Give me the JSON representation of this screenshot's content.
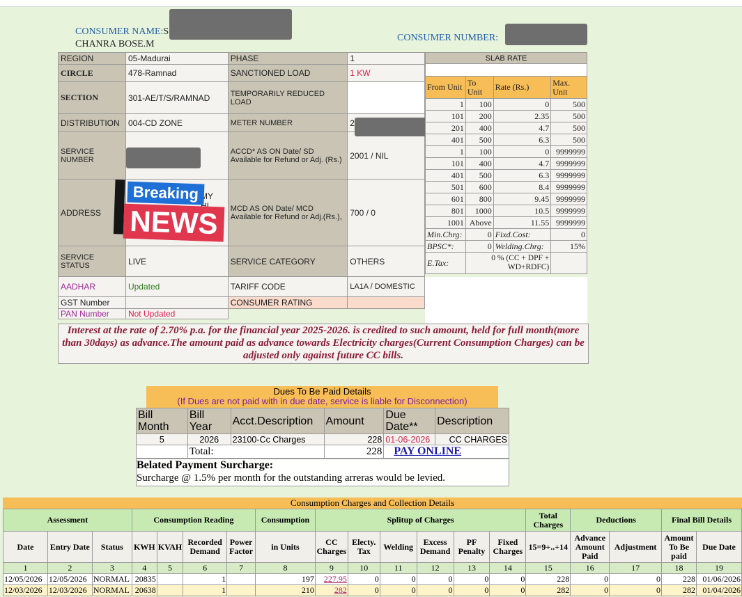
{
  "header": {
    "consumer_name_label": "CONSUMER NAME:",
    "consumer_name_partial": "S",
    "consumer_name_line2": "CHANRA BOSE.M",
    "consumer_number_label": "CONSUMER NUMBER:"
  },
  "info": {
    "region_label": "REGION",
    "region_value": "05-Madurai",
    "phase_label": "PHASE",
    "phase_value": "1",
    "circle_label": "CIRCLE",
    "circle_value": "478-Ramnad",
    "sanctioned_label": "SANCTIONED LOAD",
    "sanctioned_value": "1 KW",
    "section_label": "SECTION",
    "section_value": "301-AE/T/S/RAMNAD",
    "temp_load_label": "TEMPORARILY REDUCED LOAD",
    "distribution_label": "DISTRIBUTION",
    "distribution_value": "004-CD ZONE",
    "meter_label": "METER NUMBER",
    "meter_partial": "2",
    "service_number_label": "SERVICE NUMBER",
    "accd_label": "ACCD* AS ON Date/ SD Available for Refund or Adj. (Rs.)",
    "accd_value": "2001 / NIL",
    "address_label": "ADDRESS",
    "address_frag1": "MY",
    "address_frag2": "HI",
    "mcd_label": "MCD AS ON Date/ MCD Available for Refund or Adj.(Rs.),",
    "mcd_value": "700 / 0",
    "service_status_label": "SERVICE STATUS",
    "service_status_value": "LIVE",
    "service_category_label": "SERVICE CATEGORY",
    "service_category_value": "OTHERS",
    "aadhar_label": "AADHAR",
    "aadhar_value": "Updated",
    "tariff_label": "TARIFF CODE",
    "tariff_value": "LA1A / DOMESTIC",
    "gst_label": "GST Number",
    "consumer_rating_label": "CONSUMER RATING",
    "pan_label": "PAN Number",
    "pan_value": "Not Updated"
  },
  "sticker": {
    "line1": "Breaking",
    "line2": "NEWS"
  },
  "slab": {
    "title": "SLAB RATE",
    "headers": [
      "From Unit",
      "To Unit",
      "Rate (Rs.)",
      "Max. Unit"
    ],
    "rows": [
      [
        "1",
        "100",
        "0",
        "500"
      ],
      [
        "101",
        "200",
        "2.35",
        "500"
      ],
      [
        "201",
        "400",
        "4.7",
        "500"
      ],
      [
        "401",
        "500",
        "6.3",
        "500"
      ],
      [
        "1",
        "100",
        "0",
        "9999999"
      ],
      [
        "101",
        "400",
        "4.7",
        "9999999"
      ],
      [
        "401",
        "500",
        "6.3",
        "9999999"
      ],
      [
        "501",
        "600",
        "8.4",
        "9999999"
      ],
      [
        "601",
        "800",
        "9.45",
        "9999999"
      ],
      [
        "801",
        "1000",
        "10.5",
        "9999999"
      ],
      [
        "1001",
        "Above",
        "11.55",
        "9999999"
      ]
    ],
    "min_chrg_label": "Min.Chrg:",
    "min_chrg_value": "0",
    "fixd_cost_label": "Fixd.Cost:",
    "fixd_cost_value": "0",
    "bpsc_label": "BPSC*:",
    "bpsc_value": "0",
    "welding_label": "Welding.Chrg:",
    "welding_value": "15%",
    "etax_label": "E.Tax:",
    "etax_value": "0 % (CC + DPF + WD+RDFC)"
  },
  "interest_notice": "Interest at the rate of 2.70% p.a. for the financial year 2025-2026. is credited to such amount, held for full month(more than 30days) as advance.The amount paid as advance towards Electricity charges(Current Consumption Charges) can be adjusted only against future CC bills.",
  "dues": {
    "title": "Dues To Be Paid Details",
    "warning": "(If Dues are not paid with in due date, service is liable for Disconnection)",
    "headers": [
      "Bill Month",
      "Bill Year",
      "Acct.Description",
      "Amount",
      "Due Date**",
      "Description"
    ],
    "row": {
      "month": "5",
      "year": "2026",
      "acct": "23100-Cc Charges",
      "amount": "228",
      "due_date": "01-06-2026",
      "description": "CC CHARGES"
    },
    "total_label": "Total:",
    "total_value": "228",
    "pay_online": "PAY ONLINE",
    "belated_title": "Belated Payment Surcharge:",
    "belated_text": "Surcharge @ 1.5% per month for the outstanding arreras would be levied."
  },
  "consumption": {
    "title": "Consumption Charges and Collection Details",
    "groups": [
      "Assessment",
      "Consumption Reading",
      "Consumption",
      "Splitup of Charges",
      "Total Charges",
      "Deductions",
      "Final Bill Details"
    ],
    "columns": [
      "Date",
      "Entry Date",
      "Status",
      "KWH",
      "KVAH",
      "Recorded Demand",
      "Power Factor",
      "in Units",
      "CC Charges",
      "Electy. Tax",
      "Welding",
      "Excess Demand",
      "PF Penalty",
      "Fixed Charges",
      "15=9+..+14",
      "Advance Amount Paid",
      "Adjustment",
      "Amount To Be paid",
      "Due Date"
    ],
    "col_numbers": [
      "1",
      "2",
      "3",
      "4",
      "5",
      "6",
      "7",
      "8",
      "9",
      "10",
      "11",
      "12",
      "13",
      "14",
      "15",
      "16",
      "17",
      "18",
      "19"
    ],
    "rows": [
      [
        "12/05/2026",
        "12/05/2026",
        "NORMAL",
        "20835",
        "",
        "1",
        "",
        "197",
        "227.95",
        "0",
        "0",
        "0",
        "0",
        "0",
        "228",
        "0",
        "0",
        "228",
        "01/06/2026"
      ],
      [
        "12/03/2026",
        "12/03/2026",
        "NORMAL",
        "20638",
        "",
        "1",
        "",
        "210",
        "282",
        "0",
        "0",
        "0",
        "0",
        "0",
        "282",
        "0",
        "0",
        "282",
        "01/04/2026"
      ]
    ]
  },
  "colors": {
    "label_blue": "#1f5fa8",
    "pink_label": "#a0289a",
    "green_value": "#2e7d1e",
    "red_value": "#d9234b",
    "notice_red": "#8b1a36",
    "orange_header": "#f7bd57",
    "assess_green": "#c7eab3"
  }
}
